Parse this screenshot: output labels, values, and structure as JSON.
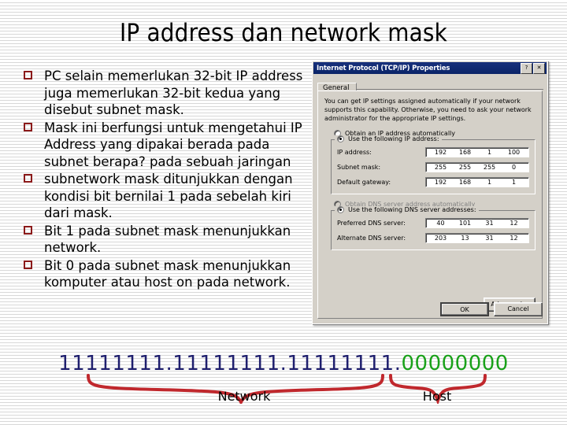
{
  "slide": {
    "title": "IP address dan network mask",
    "bullets": [
      "PC selain memerlukan 32-bit IP address juga memerlukan 32-bit kedua yang disebut subnet mask.",
      "Mask ini berfungsi untuk mengetahui IP Address yang dipakai berada pada subnet berapa?  pada sebuah jaringan",
      "subnetwork mask ditunjukkan dengan kondisi bit bernilai 1 pada sebelah kiri dari mask.",
      "Bit 1 pada subnet mask menunjukkan network.",
      "Bit 0 pada subnet mask menunjukkan komputer atau host on pada network."
    ],
    "bullet_color": "#8b1a1a"
  },
  "binary": {
    "network_bits": "11111111.11111111.11111111.",
    "host_bits": "00000000",
    "network_color": "#1f1f6e",
    "host_color": "#1aa11a",
    "brace_color": "#c0282d",
    "network_label": "Network",
    "host_label": "Host"
  },
  "dialog": {
    "title": "Internet Protocol (TCP/IP) Properties",
    "help_button": "?",
    "close_button": "✕",
    "tab": "General",
    "intro": "You can get IP settings assigned automatically if your network supports this capability. Otherwise, you need to ask your network administrator for the appropriate IP settings.",
    "radio_obtain_ip": "Obtain an IP address automatically",
    "radio_use_ip": "Use the following IP address:",
    "radio_obtain_dns": "Obtain DNS server address automatically",
    "radio_use_dns": "Use the following DNS server addresses:",
    "fields": [
      {
        "label": "IP address:",
        "octets": [
          "192",
          "168",
          "1",
          "100"
        ]
      },
      {
        "label": "Subnet mask:",
        "octets": [
          "255",
          "255",
          "255",
          "0"
        ]
      },
      {
        "label": "Default gateway:",
        "octets": [
          "192",
          "168",
          "1",
          "1"
        ]
      }
    ],
    "dns_fields": [
      {
        "label": "Preferred DNS server:",
        "octets": [
          "40",
          "101",
          "31",
          "12"
        ]
      },
      {
        "label": "Alternate DNS server:",
        "octets": [
          "203",
          "13",
          "31",
          "12"
        ]
      }
    ],
    "advanced_button": "Advanced...",
    "ok_button": "OK",
    "cancel_button": "Cancel",
    "titlebar_color": "#17307c",
    "face_color": "#d4d0c8"
  }
}
